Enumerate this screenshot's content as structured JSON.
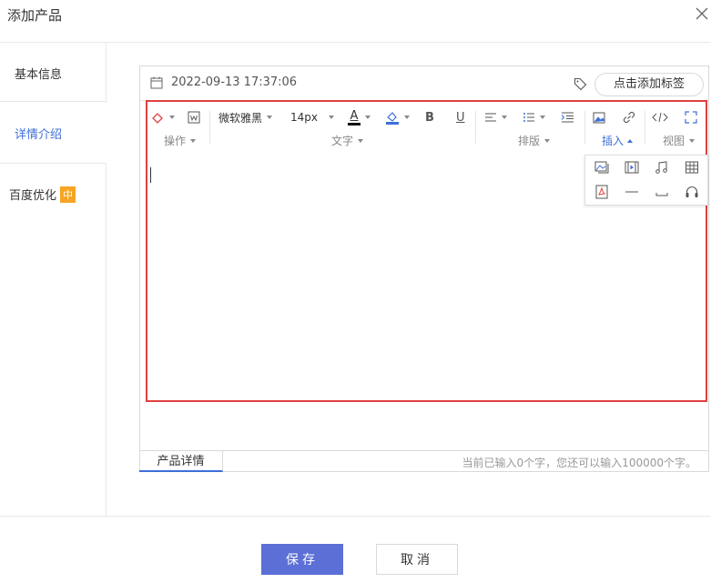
{
  "dialog": {
    "title": "添加产品"
  },
  "sidebar": {
    "items": [
      {
        "label": "基本信息"
      },
      {
        "label": "详情介绍"
      },
      {
        "label": "百度优化",
        "badge": "中"
      }
    ],
    "active_color": "#3c6fd9",
    "badge_color": "#f5a623"
  },
  "meta": {
    "datetime": "2022-09-13 17:37:06",
    "tag_button": "点击添加标签"
  },
  "toolbar": {
    "font_family": "微软雅黑",
    "font_size": "14px",
    "bold": "B",
    "underline": "U",
    "font_color_letter": "A",
    "groups": {
      "operate": "操作",
      "text": "文字",
      "layout": "排版",
      "insert": "插入",
      "view": "视图"
    }
  },
  "insert_popup": {
    "icons": [
      "image-gallery-icon",
      "video-icon",
      "music-icon",
      "table-icon",
      "pdf-icon",
      "horizontal-line-icon",
      "space-icon",
      "audio-icon"
    ]
  },
  "footer": {
    "tab": "产品详情",
    "word_count": "当前已输入0个字，您还可以输入100000个字。"
  },
  "actions": {
    "save": "保存",
    "cancel": "取消"
  },
  "colors": {
    "primary_button": "#5b6fd6",
    "highlight_frame": "#e04040"
  }
}
